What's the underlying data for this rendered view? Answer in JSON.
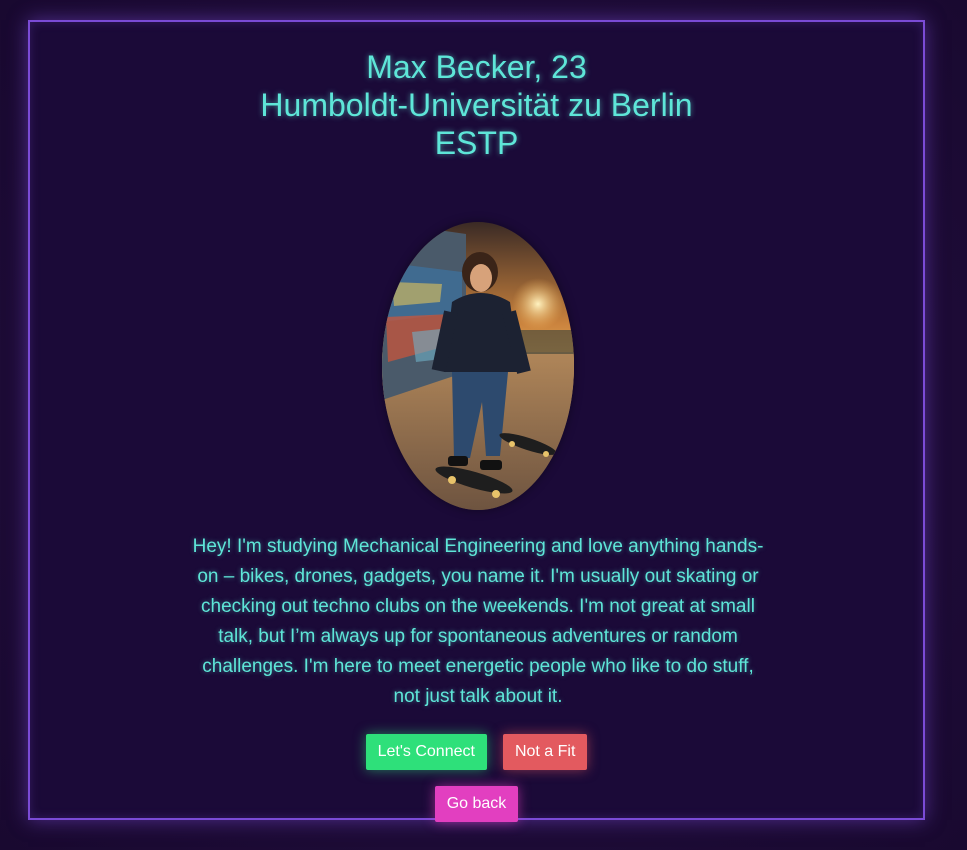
{
  "profile": {
    "name_age": "Max Becker, 23",
    "university": "Humboldt-Universität zu Berlin",
    "personality": "ESTP",
    "bio": "Hey! I'm studying Mechanical Engineering and love anything hands-on – bikes, drones, gadgets, you name it. I'm usually out skating or checking out techno clubs on the weekends. I'm not great at small talk, but I’m always up for spontaneous adventures or random challenges. I'm here to meet energetic people who like to do stuff, not just talk about it."
  },
  "actions": {
    "connect_label": "Let's Connect",
    "not_fit_label": "Not a Fit",
    "back_label": "Go back"
  },
  "colors": {
    "accent_text": "#5ee6d8",
    "border": "#7b4bd6",
    "connect": "#2ee07a",
    "not_fit": "#e35a5f",
    "back": "#e23fc0"
  }
}
